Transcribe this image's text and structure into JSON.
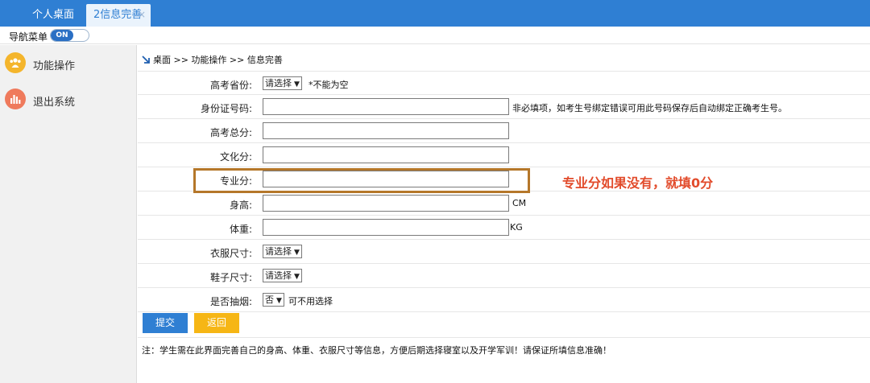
{
  "tabs": [
    {
      "label": "个人桌面"
    },
    {
      "label": "2信息完善",
      "close": "×"
    }
  ],
  "nav": {
    "label": "导航菜单",
    "toggle": "ON"
  },
  "sidebar": {
    "items": [
      {
        "label": "功能操作",
        "icon": "users-icon"
      },
      {
        "label": "退出系统",
        "icon": "chart-icon"
      }
    ]
  },
  "breadcrumb": "桌面 >> 功能操作 >> 信息完善",
  "form": {
    "province": {
      "label": "高考省份:",
      "value": "请选择",
      "hint": "*不能为空"
    },
    "id_number": {
      "label": "身份证号码:",
      "value": "",
      "hint": "非必填项，如考生号绑定错误可用此号码保存后自动绑定正确考生号。"
    },
    "total_score": {
      "label": "高考总分:",
      "value": ""
    },
    "culture_score": {
      "label": "文化分:",
      "value": ""
    },
    "major_score": {
      "label": "专业分:",
      "value": ""
    },
    "height": {
      "label": "身高:",
      "value": "",
      "unit": "CM"
    },
    "weight": {
      "label": "体重:",
      "value": "",
      "unit": "KG"
    },
    "clothes": {
      "label": "衣服尺寸:",
      "value": "请选择"
    },
    "shoes": {
      "label": "鞋子尺寸:",
      "value": "请选择"
    },
    "smoke": {
      "label": "是否抽烟:",
      "value": "否",
      "hint": "可不用选择"
    }
  },
  "annotation": "专业分如果没有，就填0分",
  "buttons": {
    "submit": "提交",
    "back": "返回"
  },
  "footnote": "注：学生需在此界面完善自己的身高、体重、衣服尺寸等信息，方便后期选择寝室以及开学军训！请保证所填信息准确！",
  "colors": {
    "topbar": "#2f7fd3",
    "highlight": "#b5772a",
    "annotation": "#e24b2b",
    "back_button": "#f6b615"
  }
}
